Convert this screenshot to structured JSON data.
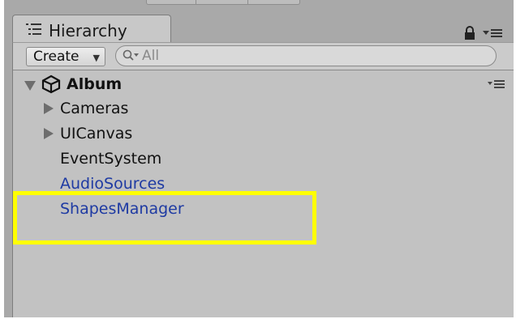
{
  "window": {
    "tab_label": "Hierarchy"
  },
  "toolbar": {
    "create_label": "Create",
    "create_caret": "▼",
    "search_placeholder": "All"
  },
  "scene": {
    "name": "Album",
    "expanded": true
  },
  "hierarchy": {
    "items": [
      {
        "label": "Cameras",
        "has_children": true
      },
      {
        "label": "UICanvas",
        "has_children": true
      },
      {
        "label": "EventSystem",
        "has_children": false
      },
      {
        "label": "AudioSources",
        "has_children": false,
        "color": "#1e3aa3"
      },
      {
        "label": "ShapesManager",
        "has_children": false,
        "color": "#1e3aa3",
        "highlighted": true
      }
    ]
  },
  "colors": {
    "highlight_border": "#ffff00",
    "prefab_text": "#1e3aa3",
    "panel_bg": "#c2c2c2"
  },
  "icons": {
    "tab": "list-icon",
    "lock": "lock-icon",
    "panel_menu": "menu-icon",
    "scene": "unity-logo-icon",
    "search": "search-icon"
  }
}
